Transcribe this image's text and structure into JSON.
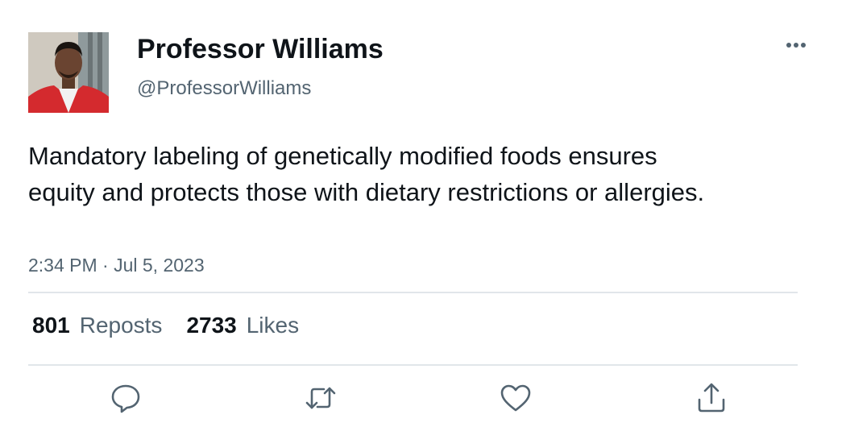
{
  "author": {
    "display_name": "Professor Williams",
    "handle": "@ProfessorWilliams",
    "avatar_icon": "profile-photo"
  },
  "more_icon": "more-options-icon",
  "tweet": {
    "text": "Mandatory labeling of genetically modified foods ensures equity and protects those with dietary restrictions or allergies.",
    "timestamp": "2:34 PM · Jul 5, 2023"
  },
  "stats": {
    "reposts_count": "801",
    "reposts_label": "Reposts",
    "likes_count": "2733",
    "likes_label": "Likes"
  },
  "actions": [
    {
      "name": "reply",
      "icon": "speech-bubble-icon"
    },
    {
      "name": "repost",
      "icon": "repost-arrows-icon"
    },
    {
      "name": "like",
      "icon": "heart-icon"
    },
    {
      "name": "share",
      "icon": "share-upload-icon"
    }
  ],
  "colors": {
    "text_primary": "#0f1419",
    "text_secondary": "#536471",
    "divider": "#e1e6ea"
  }
}
